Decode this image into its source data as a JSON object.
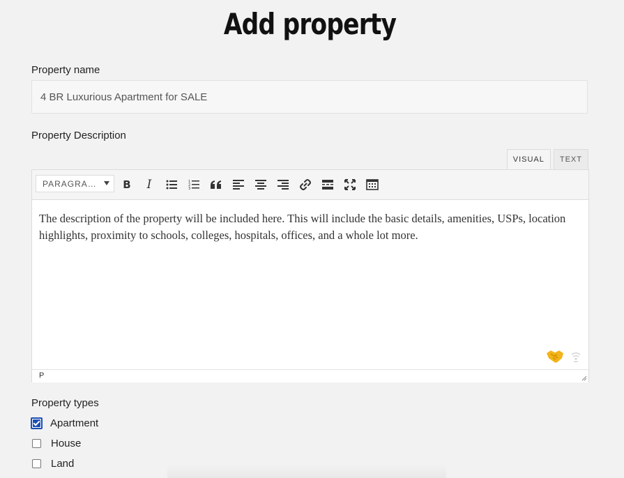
{
  "page": {
    "title": "Add property"
  },
  "property_name": {
    "label": "Property name",
    "value": "4 BR Luxurious Apartment for SALE"
  },
  "description": {
    "label": "Property Description",
    "tabs": [
      {
        "label": "VISUAL",
        "active": true
      },
      {
        "label": "TEXT",
        "active": false
      }
    ],
    "toolbar": {
      "format_select": "PARAGRA…",
      "buttons": [
        {
          "name": "bold-icon",
          "glyph": "B"
        },
        {
          "name": "italic-icon",
          "glyph": "I"
        },
        {
          "name": "bullet-list-icon"
        },
        {
          "name": "numbered-list-icon"
        },
        {
          "name": "blockquote-icon"
        },
        {
          "name": "align-left-icon"
        },
        {
          "name": "align-center-icon"
        },
        {
          "name": "align-right-icon"
        },
        {
          "name": "link-icon"
        },
        {
          "name": "read-more-icon"
        },
        {
          "name": "fullscreen-icon"
        },
        {
          "name": "toolbar-toggle-icon"
        }
      ]
    },
    "content": "The description of the property will be included here. This will include the basic details, amenities, USPs, location highlights, proximity to schools, colleges, hospitals, offices, and a whole lot more.",
    "status_path": "P"
  },
  "property_types": {
    "label": "Property types",
    "options": [
      {
        "label": "Apartment",
        "checked": true
      },
      {
        "label": "House",
        "checked": false
      },
      {
        "label": "Land",
        "checked": false
      }
    ]
  },
  "colors": {
    "checkbox_accent": "#1a4fb5",
    "background": "#f2f2f2"
  }
}
